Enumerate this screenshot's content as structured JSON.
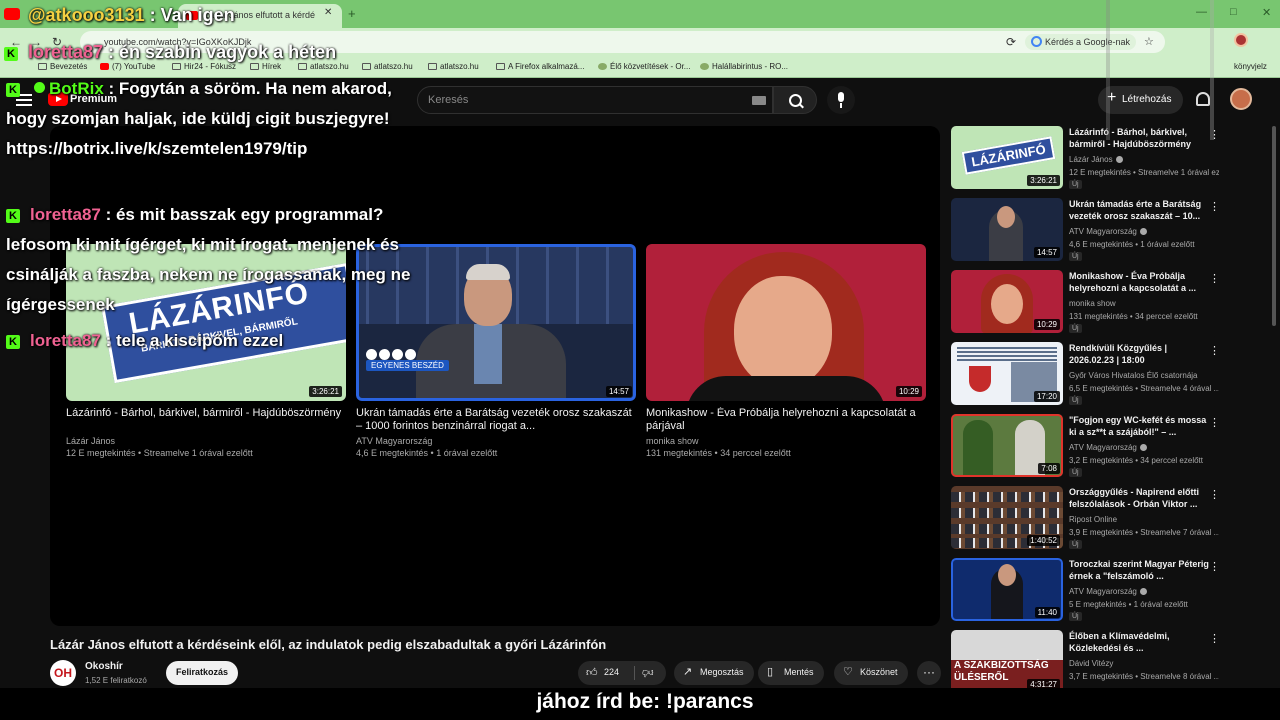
{
  "browser": {
    "tab_title": "Lázár János elfutott a kérdé",
    "tab_close": "✕",
    "tab_new": "+",
    "win_controls": [
      "—",
      "□",
      "✕"
    ],
    "url": "youtube.com/watch?v=IGoXKoKJDjk",
    "google_button": "Kérdés a Google-nak",
    "bookmarks": [
      {
        "label": "Bevezetés",
        "icon": "page-icon"
      },
      {
        "label": "(7) YouTube",
        "icon": "youtube-icon"
      },
      {
        "label": "Hir24 - Fókusz",
        "icon": "folder-icon"
      },
      {
        "label": "Hírek",
        "icon": "folder-icon"
      },
      {
        "label": "atlatszo.hu",
        "icon": "page-icon"
      },
      {
        "label": "atlatszo.hu",
        "icon": "folder-icon"
      },
      {
        "label": "atlatszo.hu",
        "icon": "folder-icon"
      },
      {
        "label": "A Firefox alkalmazá...",
        "icon": "folder-icon"
      },
      {
        "label": "Élő közvetítések - Or...",
        "icon": "page-icon"
      },
      {
        "label": "Halállabirintus - RO...",
        "icon": "page-icon"
      }
    ],
    "bookmarks_other": "könyvjelz"
  },
  "masthead": {
    "premium": "Premium",
    "search_placeholder": "Keresés",
    "create": "Létrehozás"
  },
  "endscreen": [
    {
      "title": "Lázárinfó - Bárhol, bárkivel, bármiről - Hajdúböszörmény",
      "channel": "Lázár János",
      "meta": "12 E megtekintés • Streamelve 1 órával ezelőtt",
      "duration": "3:26:21",
      "art_text": "LÁZÁRINFÓ",
      "art_sub": "BÁRHOL, BÁRKIVEL, BÁRMIRŐL"
    },
    {
      "title": "Ukrán támadás érte a Barátság vezeték orosz szakaszát – 1000 forintos benzinárral riogat a...",
      "channel": "ATV Magyarország",
      "meta": "4,6 E megtekintés • 1 órával ezelőtt",
      "duration": "14:57",
      "art_text": "EGYENES BESZÉD",
      "art_letters": "a t v"
    },
    {
      "title": "Monikashow - Éva Próbálja helyrehozni a kapcsolatát a párjával",
      "channel": "monika show",
      "meta": "131 megtekintés • 34 perccel ezelőtt",
      "duration": "10:29"
    }
  ],
  "video": {
    "title": "Lázár János elfutott a kérdéseink elől, az indulatok pedig elszabadultak a győri Lázárinfón",
    "channel": "Okoshír",
    "channel_initials": "OH",
    "subscribers": "1,52 E feliratkozó",
    "subscribe": "Feliratkozás",
    "likes": "224",
    "share": "Megosztás",
    "save": "Mentés",
    "thanks": "Köszönet",
    "more": "···"
  },
  "sidebar": [
    {
      "title": "Lázárinfó - Bárhol, bárkivel, bármiről - Hajdúböszörmény",
      "channel": "Lázár János",
      "verified": true,
      "meta": "12 E megtekintés • Streamelve 1 órával ezelőtt",
      "duration": "3:26:21",
      "new": "Új",
      "art": "lz",
      "art_text": "LÁZÁRINFÓ"
    },
    {
      "title": "Ukrán támadás érte a Barátság vezeték orosz szakaszát – 10...",
      "channel": "ATV Magyarország",
      "verified": true,
      "meta": "4,6 E megtekintés • 1 órával ezelőtt",
      "duration": "14:57",
      "new": "Új",
      "art": "dark"
    },
    {
      "title": "Monikashow - Éva Próbálja helyrehozni a kapcsolatát a ...",
      "channel": "monika show",
      "verified": false,
      "meta": "131 megtekintés • 34 perccel ezelőtt",
      "duration": "10:29",
      "new": "Új",
      "art": "red"
    },
    {
      "title": "Rendkívüli Közgyűlés | 2026.02.23 | 18:00",
      "channel": "Győr Város Hivatalos Élő csatornája",
      "verified": false,
      "meta": "6,5 E megtekintés • Streamelve 4 órával ...",
      "duration": "17:20",
      "new": "Új",
      "art": "white"
    },
    {
      "title": "\"Fogjon egy WC-kefét és mossa ki a sz**t a szájából!\" – ...",
      "channel": "ATV Magyarország",
      "verified": true,
      "meta": "3,2 E megtekintés • 34 perccel ezelőtt",
      "duration": "7:08",
      "new": "Új",
      "art": "green"
    },
    {
      "title": "Országgyűlés - Napirend előtti felszólalások - Orbán Viktor ...",
      "channel": "Ripost Online",
      "verified": false,
      "meta": "3,9 E megtekintés • Streamelve 7 órával ...",
      "duration": "1:40:52",
      "new": "Új",
      "art": "parl"
    },
    {
      "title": "Toroczkai szerint Magyar Péterig érnek a \"felszámoló ...",
      "channel": "ATV Magyarország",
      "verified": true,
      "meta": "5 E megtekintés • 1 órával ezelőtt",
      "duration": "11:40",
      "new": "Új",
      "art": "blue"
    },
    {
      "title": "Élőben a Klímavédelmi, Közlekedési és ...",
      "channel": "Dávid Vitézy",
      "verified": false,
      "meta": "3,7 E megtekintés • Streamelve 8 órával ...",
      "duration": "4:31:27",
      "new": "",
      "art": "pr",
      "art_text": "A SZAKBIZOTTSÁG ÜLÉSERŐL"
    }
  ],
  "overlay": {
    "top1": {
      "user": "@atkooo3131",
      "text": " : Van igen"
    },
    "top2": {
      "user": "loretta87",
      "text": " : én szabin vagyok a héten"
    },
    "messages": [
      {
        "user": "BotRix",
        "text": " : Fogytán a söröm. Ha nem akarod, hogy szomjan haljak, ide küldj cigit buszjegyre! https://botrix.live/k/szemtelen1979/tip"
      },
      {
        "user": "loretta87",
        "text": " : és mit basszak egy programmal? lefosom ki mit ígérget, ki mit írogat. menjenek és csinálják a faszba, nekem ne írogassanak, meg ne ígérgessenek"
      },
      {
        "user": "loretta87",
        "text": " : tele a kiscipőm ezzel"
      }
    ],
    "caption": "jához írd be: !parancs"
  }
}
